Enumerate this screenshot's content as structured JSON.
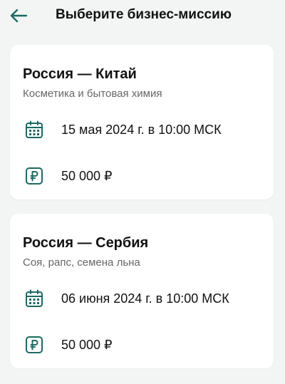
{
  "header": {
    "title": "Выберите бизнес-миссию",
    "back_icon": "arrow-left-icon",
    "accent_color": "#1a6a63"
  },
  "missions": [
    {
      "title": "Россия — Китай",
      "subtitle": "Косметика и бытовая химия",
      "date": "15 мая 2024 г. в 10:00 МСК",
      "price": "50 000 ₽",
      "date_icon": "calendar-icon",
      "price_icon": "ruble-icon"
    },
    {
      "title": "Россия — Сербия",
      "subtitle": "Соя, рапс, семена льна",
      "date": "06 июня 2024 г. в 10:00 МСК",
      "price": "50 000 ₽",
      "date_icon": "calendar-icon",
      "price_icon": "ruble-icon"
    }
  ]
}
